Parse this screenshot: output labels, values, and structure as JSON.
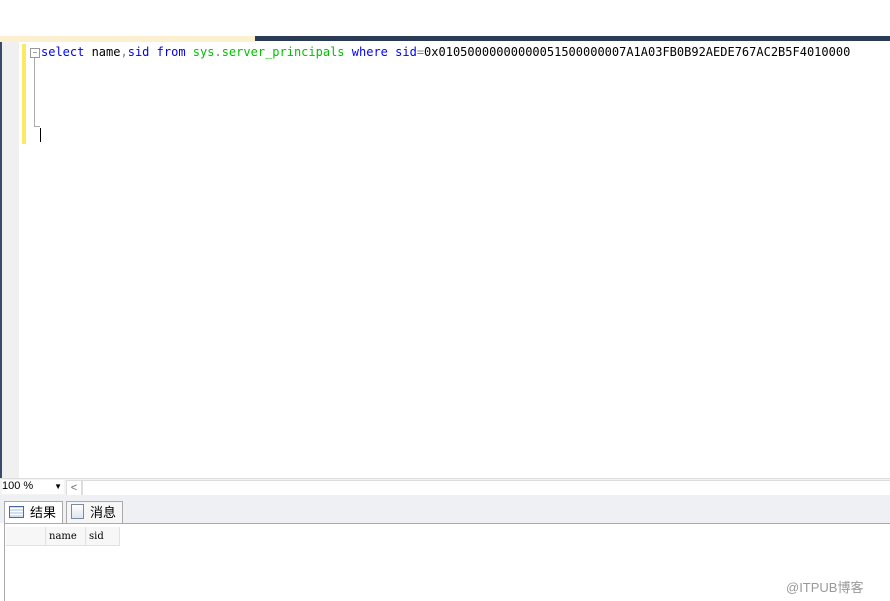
{
  "editor": {
    "collapse_glyph": "⊟",
    "tokens": [
      {
        "t": "select",
        "c": "kw"
      },
      {
        "t": " name",
        "c": "plain"
      },
      {
        "t": ",",
        "c": "op"
      },
      {
        "t": "sid",
        "c": "kw"
      },
      {
        "t": " ",
        "c": "plain"
      },
      {
        "t": "from",
        "c": "kw"
      },
      {
        "t": " ",
        "c": "plain"
      },
      {
        "t": "sys",
        "c": "sys"
      },
      {
        "t": ".",
        "c": "op"
      },
      {
        "t": "server_principals",
        "c": "sys"
      },
      {
        "t": " ",
        "c": "plain"
      },
      {
        "t": "where",
        "c": "kw"
      },
      {
        "t": " ",
        "c": "plain"
      },
      {
        "t": "sid",
        "c": "kw"
      },
      {
        "t": "=",
        "c": "op"
      },
      {
        "t": "0x01050000000000051500000007A1A03FB0B92AEDE767AC2B5F4010000",
        "c": "plain"
      }
    ]
  },
  "status": {
    "zoom": "100 %",
    "scroll_left": "<"
  },
  "tabs": [
    {
      "label": "结果",
      "icon": "grid-icon"
    },
    {
      "label": "消息",
      "icon": "messages-icon"
    }
  ],
  "grid": {
    "columns": [
      "name",
      "sid"
    ]
  },
  "watermark": "@ITPUB博客"
}
